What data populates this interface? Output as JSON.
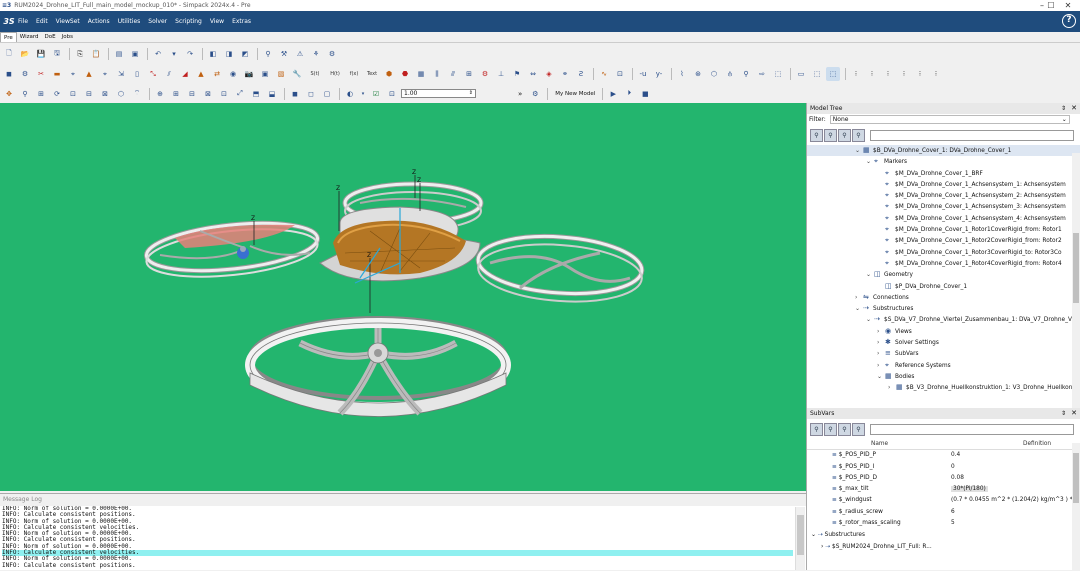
{
  "window": {
    "title": "RUM2024_Drohne_LIT_Full_main_model_mockup_010* - Simpack 2024x.4 - Pre",
    "minimize": "–",
    "maximize": "☐",
    "close": "✕"
  },
  "menubar": {
    "logo": "3S",
    "items": [
      "File",
      "Edit",
      "ViewSet",
      "Actions",
      "Utilities",
      "Solver",
      "Scripting",
      "View",
      "Extras"
    ],
    "help": "?"
  },
  "tabs": [
    "Pre",
    "Wizard",
    "DoE",
    "Jobs"
  ],
  "toolbar3": {
    "labels": [
      "S(t)",
      "H(t)",
      "f(x)",
      "Text"
    ],
    "zoom_value": "1.00",
    "model_name": "My New Model",
    "arrows": "»"
  },
  "viewport": {
    "background": "#23b56e",
    "axis_labels": [
      "Z",
      "Z",
      "Z",
      "Z",
      "Z"
    ]
  },
  "message_log": {
    "title": "Message Log",
    "lines": [
      "INFO:     Norm of solution = 0.0000E+00.",
      "INFO:     Calculate consistent positions.",
      "INFO:     Norm of solution = 0.0000E+00.",
      "INFO:     Calculate consistent velocities.",
      "INFO:     Norm of solution = 0.0000E+00.",
      "INFO:     Calculate consistent positions.",
      "INFO:     Norm of solution = 0.0000E+00.",
      "INFO:     Calculate consistent velocities.",
      "INFO:     Norm of solution = 0.0000E+00.",
      "INFO:     Calculate consistent positions."
    ],
    "highlight_index": 7
  },
  "model_tree": {
    "title": "Model Tree",
    "filter_label": "Filter:",
    "filter_value": "None",
    "nodes": [
      {
        "indent": 0,
        "arrow": "⌄",
        "icon": "▦",
        "text": "$B_DVa_Drohne_Cover_1: DVa_Drohne_Cover_1",
        "sel": true
      },
      {
        "indent": 1,
        "arrow": "⌄",
        "icon": "⌖",
        "text": "Markers"
      },
      {
        "indent": 2,
        "arrow": "",
        "icon": "⌖",
        "text": "$M_DVa_Drohne_Cover_1_BRF"
      },
      {
        "indent": 2,
        "arrow": "",
        "icon": "⌖",
        "text": "$M_DVa_Drohne_Cover_1_Achsensystem_1: Achsensystem"
      },
      {
        "indent": 2,
        "arrow": "",
        "icon": "⌖",
        "text": "$M_DVa_Drohne_Cover_1_Achsensystem_2: Achsensystem"
      },
      {
        "indent": 2,
        "arrow": "",
        "icon": "⌖",
        "text": "$M_DVa_Drohne_Cover_1_Achsensystem_3: Achsensystem"
      },
      {
        "indent": 2,
        "arrow": "",
        "icon": "⌖",
        "text": "$M_DVa_Drohne_Cover_1_Achsensystem_4: Achsensystem"
      },
      {
        "indent": 2,
        "arrow": "",
        "icon": "⌖",
        "text": "$M_DVa_Drohne_Cover_1_Rotor1CoverRigid_from: Rotor1"
      },
      {
        "indent": 2,
        "arrow": "",
        "icon": "⌖",
        "text": "$M_DVa_Drohne_Cover_1_Rotor2CoverRigid_from: Rotor2"
      },
      {
        "indent": 2,
        "arrow": "",
        "icon": "⌖",
        "text": "$M_DVa_Drohne_Cover_1_Rotor3CoverRigid_to: Rotor3Co"
      },
      {
        "indent": 2,
        "arrow": "",
        "icon": "⌖",
        "text": "$M_DVa_Drohne_Cover_1_Rotor4CoverRigid_from: Rotor4"
      },
      {
        "indent": 1,
        "arrow": "⌄",
        "icon": "◫",
        "text": "Geometry"
      },
      {
        "indent": 2,
        "arrow": "",
        "icon": "◫",
        "text": "$P_DVa_Drohne_Cover_1"
      },
      {
        "indent": 0,
        "arrow": "›",
        "icon": "⇋",
        "text": "Connections"
      },
      {
        "indent": 0,
        "arrow": "⌄",
        "icon": "⇢",
        "text": "Substructures"
      },
      {
        "indent": 1,
        "arrow": "⌄",
        "icon": "⇢",
        "text": "$S_DVa_V7_Drohne_Viertel_Zusammenbau_1: DVa_V7_Drohne_Vie"
      },
      {
        "indent": 2,
        "arrow": "›",
        "icon": "◉",
        "text": "Views"
      },
      {
        "indent": 2,
        "arrow": "›",
        "icon": "✱",
        "text": "Solver Settings"
      },
      {
        "indent": 2,
        "arrow": "›",
        "icon": "≡",
        "text": "SubVars"
      },
      {
        "indent": 2,
        "arrow": "›",
        "icon": "⌖",
        "text": "Reference Systems"
      },
      {
        "indent": 2,
        "arrow": "⌄",
        "icon": "▦",
        "text": "Bodies"
      },
      {
        "indent": 3,
        "arrow": "›",
        "icon": "▦",
        "text": "$B_V3_Drohne_Huellkonstruktion_1: V3_Drohne_Huellkon"
      }
    ]
  },
  "subvars": {
    "title": "SubVars",
    "col_name": "Name",
    "col_definition": "Definition",
    "rows": [
      {
        "name": "$_POS_PID_P",
        "def": "0.4"
      },
      {
        "name": "$_POS_PID_I",
        "def": "0"
      },
      {
        "name": "$_POS_PID_D",
        "def": "0.08"
      },
      {
        "name": "$_max_tilt",
        "def": "30*(Pi/180)"
      },
      {
        "name": "$_windgust",
        "def": "(0.7 * 0.0455 m^2 * (1.204/2) kg/m^3 ) * ("
      },
      {
        "name": "$_radius_screw",
        "def": "6"
      },
      {
        "name": "$_rotor_mass_scaling",
        "def": "5"
      }
    ],
    "group": "Substructures",
    "group_child": "$S_RUM2024_Drohne_LIT_Full: R..."
  },
  "colors": {
    "menubar": "#1f4c7d",
    "viewport": "#23b56e",
    "highlight": "#8ff0f0",
    "cover_orange": "#c98a2e"
  }
}
